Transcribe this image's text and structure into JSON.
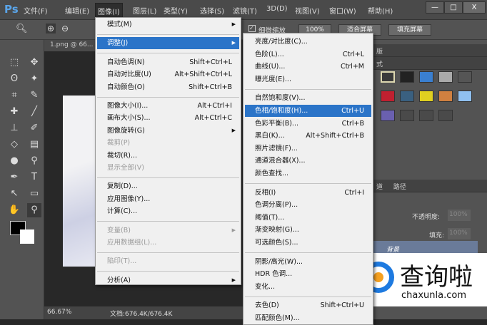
{
  "app": {
    "logo": "Ps",
    "window_controls": [
      "—",
      "□",
      "X"
    ]
  },
  "menubar": [
    "文件(F)",
    "编辑(E)",
    "图像(I)",
    "图层(L)",
    "类型(Y)",
    "选择(S)",
    "滤镜(T)",
    "3D(D)",
    "视图(V)",
    "窗口(W)",
    "帮助(H)"
  ],
  "options": {
    "checkbox_label": "细微缩放",
    "zoom_value": "100%",
    "fit_screen": "适合屏幕",
    "fill_screen": "填充屏幕"
  },
  "document": {
    "tab": "1.png @ 66...",
    "zoom": "66.67%",
    "doc_size": "文档:676.4K/676.4K"
  },
  "image_menu": [
    {
      "label": "模式(M)",
      "sub": true
    },
    {
      "sep": true
    },
    {
      "label": "调整(J)",
      "sub": true,
      "hl": true
    },
    {
      "sep": true
    },
    {
      "label": "自动色调(N)",
      "shortcut": "Shift+Ctrl+L"
    },
    {
      "label": "自动对比度(U)",
      "shortcut": "Alt+Shift+Ctrl+L"
    },
    {
      "label": "自动颜色(O)",
      "shortcut": "Shift+Ctrl+B"
    },
    {
      "sep": true
    },
    {
      "label": "图像大小(I)...",
      "shortcut": "Alt+Ctrl+I"
    },
    {
      "label": "画布大小(S)...",
      "shortcut": "Alt+Ctrl+C"
    },
    {
      "label": "图像旋转(G)",
      "sub": true
    },
    {
      "label": "裁剪(P)",
      "dis": true
    },
    {
      "label": "裁切(R)..."
    },
    {
      "label": "显示全部(V)",
      "dis": true
    },
    {
      "sep": true
    },
    {
      "label": "复制(D)..."
    },
    {
      "label": "应用图像(Y)..."
    },
    {
      "label": "计算(C)..."
    },
    {
      "sep": true
    },
    {
      "label": "变量(B)",
      "sub": true,
      "dis": true
    },
    {
      "label": "应用数据组(L)...",
      "dis": true
    },
    {
      "sep": true
    },
    {
      "label": "陷印(T)...",
      "dis": true
    },
    {
      "sep": true
    },
    {
      "label": "分析(A)",
      "sub": true
    }
  ],
  "adjust_menu": [
    {
      "label": "亮度/对比度(C)..."
    },
    {
      "label": "色阶(L)...",
      "shortcut": "Ctrl+L"
    },
    {
      "label": "曲线(U)...",
      "shortcut": "Ctrl+M"
    },
    {
      "label": "曝光度(E)..."
    },
    {
      "sep": true
    },
    {
      "label": "自然饱和度(V)..."
    },
    {
      "label": "色相/饱和度(H)...",
      "shortcut": "Ctrl+U",
      "hl": true
    },
    {
      "label": "色彩平衡(B)...",
      "shortcut": "Ctrl+B"
    },
    {
      "label": "黑白(K)...",
      "shortcut": "Alt+Shift+Ctrl+B"
    },
    {
      "label": "照片滤镜(F)..."
    },
    {
      "label": "通道混合器(X)..."
    },
    {
      "label": "颜色查找..."
    },
    {
      "sep": true
    },
    {
      "label": "反相(I)",
      "shortcut": "Ctrl+I"
    },
    {
      "label": "色调分离(P)..."
    },
    {
      "label": "阈值(T)..."
    },
    {
      "label": "渐变映射(G)..."
    },
    {
      "label": "可选颜色(S)..."
    },
    {
      "sep": true
    },
    {
      "label": "阴影/高光(W)..."
    },
    {
      "label": "HDR 色调..."
    },
    {
      "label": "变化..."
    },
    {
      "sep": true
    },
    {
      "label": "去色(D)",
      "shortcut": "Shift+Ctrl+U"
    },
    {
      "label": "匹配颜色(M)..."
    }
  ],
  "panels": {
    "tab1": "版",
    "tab2": "式",
    "layers_tabs": [
      "道",
      "路径"
    ],
    "opacity_label": "不透明度:",
    "opacity_value": "100%",
    "fill_label": "填充:",
    "fill_value": "100%",
    "layer_name": "背景"
  },
  "style_colors": [
    "#3a3a3a",
    "#222",
    "#3a7fd0",
    "#aaa",
    "#555",
    "#c02030",
    "#3a6080",
    "#e0d020",
    "#d08040",
    "#90c0f0",
    "#6a60b0",
    "#4a4a4a",
    "#4a4a4a",
    "#4a4a4a"
  ],
  "watermark": {
    "name": "查询啦",
    "url": "chaxunla.com"
  }
}
